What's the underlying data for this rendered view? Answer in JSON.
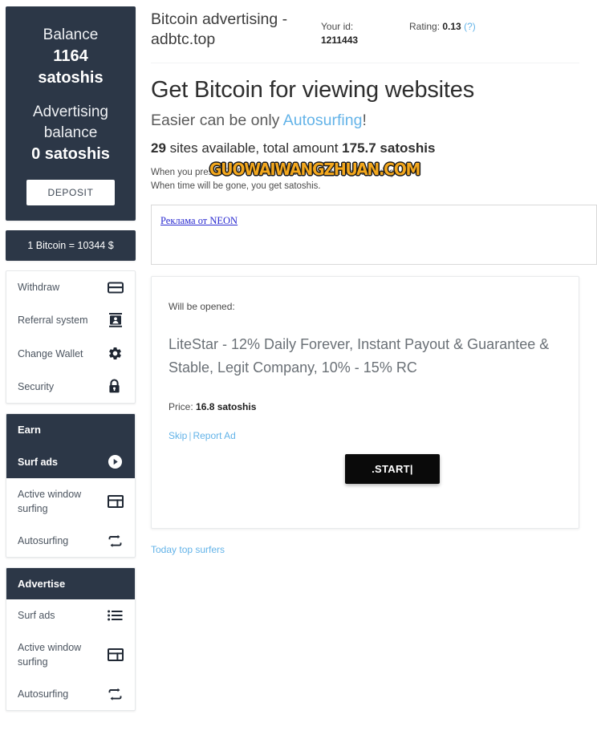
{
  "sidebar": {
    "balance": {
      "balance_label": "Balance",
      "balance_value": "1164",
      "balance_unit": "satoshis",
      "adv_label_line1": "Advertising",
      "adv_label_line2": "balance",
      "adv_value": "0 satoshis",
      "deposit_label": "DEPOSIT"
    },
    "rate": "1 Bitcoin = 10344 $",
    "account_items": [
      {
        "label": "Withdraw",
        "icon": "credit-card-icon"
      },
      {
        "label": "Referral system",
        "icon": "id-card-icon"
      },
      {
        "label": "Change Wallet",
        "icon": "gear-icon"
      },
      {
        "label": "Security",
        "icon": "lock-icon"
      }
    ],
    "earn": {
      "header": "Earn",
      "active_label": "Surf ads",
      "active_icon": "play-circle-icon",
      "items": [
        {
          "label": "Active window surfing",
          "icon": "window-icon"
        },
        {
          "label": "Autosurfing",
          "icon": "loop-icon"
        }
      ]
    },
    "advertise": {
      "header": "Advertise",
      "items": [
        {
          "label": "Surf ads",
          "icon": "list-icon"
        },
        {
          "label": "Active window surfing",
          "icon": "window-icon"
        },
        {
          "label": "Autosurfing",
          "icon": "loop-icon"
        }
      ]
    }
  },
  "header": {
    "site_title": "Bitcoin advertising - adbtc.top",
    "id_label": "Your id:",
    "id_value": "1211443",
    "rating_label": "Rating:",
    "rating_value": "0.13",
    "rating_help": "(?)"
  },
  "main": {
    "h1": "Get Bitcoin for viewing websites",
    "h2_prefix": "Easier can be only ",
    "h2_link": "Autosurfing",
    "h2_suffix": "!",
    "h3_count": "29",
    "h3_text": " sites available, total amount ",
    "h3_amount": "175.7 satoshis",
    "desc_line1": "When you press START, don't close it before timer is ticking.",
    "desc_line2": "When time will be gone, you get satoshis.",
    "watermark": "GUOWAIWANGZHUAN.COM",
    "neon_link": "Реклама от NEON",
    "ad": {
      "will_be_opened": "Will be opened:",
      "ad_text": "LiteStar - 12% Daily Forever, Instant Payout & Guarantee & Stable, Legit Company, 10% - 15% RC",
      "price_label": "Price: ",
      "price_value": "16.8 satoshis",
      "skip_label": "Skip",
      "separator": "|",
      "report_label": "Report Ad",
      "start_label": ".START|"
    },
    "today_top_surfers": "Today top surfers"
  },
  "colors": {
    "navy": "#2c3747",
    "link_blue": "#63b3e8",
    "watermark_gold": "#f4a81d"
  }
}
